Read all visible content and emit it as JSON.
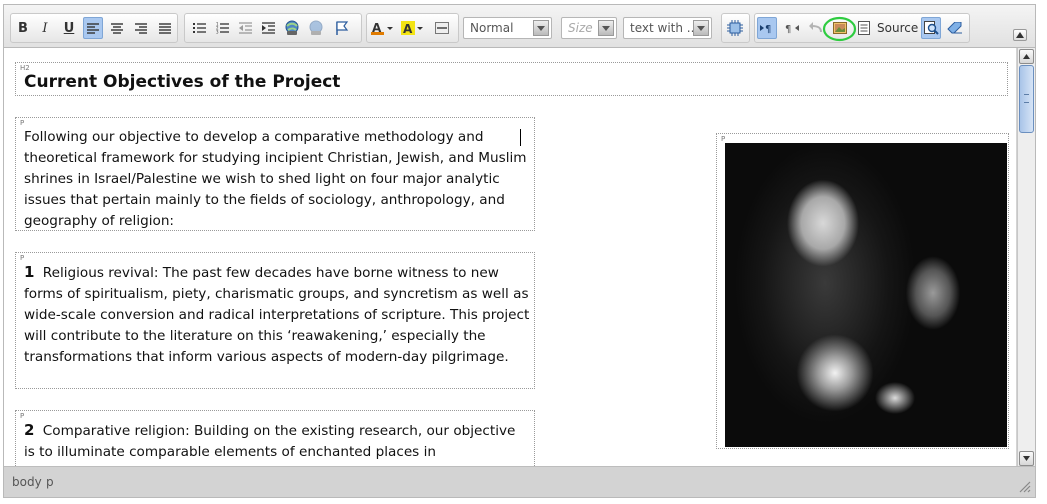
{
  "toolbar": {
    "format_value": "Normal",
    "size_placeholder": "Size",
    "style_value": "text with ...",
    "source_label": "Source",
    "buttons": {
      "bold": "B",
      "italic": "I",
      "underline": "U"
    }
  },
  "content": {
    "heading_tag": "H2",
    "heading": "Current Objectives of the Project",
    "para_tag": "P",
    "intro": "Following our objective to develop a comparative methodology and theoretical framework for studying incipient Christian, Jewish, and Muslim shrines in Israel/Palestine we wish to shed light on four major analytic issues that pertain mainly to the fields of sociology, anthropology, and geography of religion:",
    "items": [
      {
        "number": "1",
        "text": "Religious revival: The past few decades have borne witness to new forms of spiritualism, piety, charismatic groups, and syncretism as well as wide-scale conversion and radical interpretations of scripture. This project will contribute to the literature on this ‘reawakening,’ especially the transformations that inform various aspects of modern-day pilgrimage."
      },
      {
        "number": "2",
        "text": "Comparative religion: Building on the existing research, our objective is to illuminate comparable elements of enchanted places in"
      }
    ],
    "image_tag": "P"
  },
  "status": {
    "path": [
      "body",
      "p"
    ]
  },
  "colors": {
    "active_button": "#a9c8f0",
    "highlight_ring": "#2ecc40"
  }
}
